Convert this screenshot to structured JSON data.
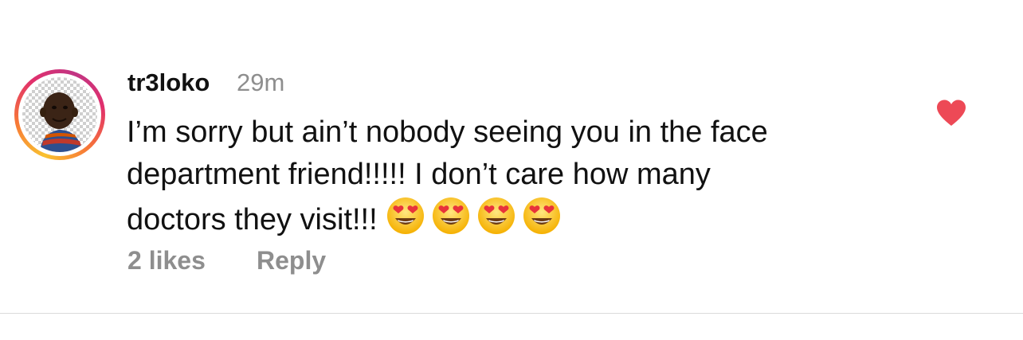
{
  "comment": {
    "username": "tr3loko",
    "time": "29m",
    "text_lines": [
      "I’m sorry but ain’t nobody seeing you in the face",
      "department friend!!!!! I don’t care how many",
      "doctors they visit!!!"
    ],
    "emojis": [
      "smiling-face-with-heart-eyes",
      "smiling-face-with-heart-eyes",
      "smiling-face-with-heart-eyes",
      "smiling-face-with-heart-eyes"
    ],
    "likes_label": "2 likes",
    "reply_label": "Reply",
    "liked": true
  },
  "colors": {
    "heart": "#ed4956",
    "meta_text": "#8e8e8e",
    "ring_gradient": [
      "#f9c230",
      "#f77737",
      "#e1306c",
      "#c13584"
    ]
  }
}
